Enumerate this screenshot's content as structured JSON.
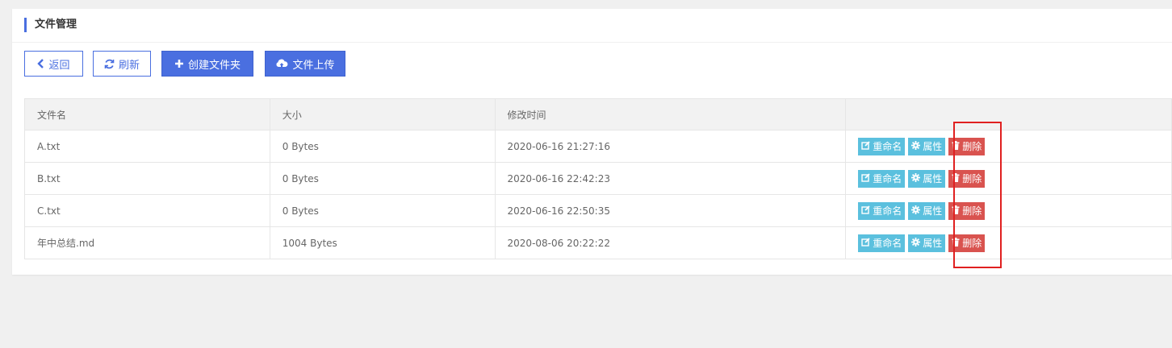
{
  "panel": {
    "title": "文件管理"
  },
  "toolbar": {
    "back_label": "返回",
    "refresh_label": "刷新",
    "new_folder_label": "创建文件夹",
    "upload_label": "文件上传"
  },
  "table": {
    "columns": [
      "文件名",
      "大小",
      "修改时间",
      ""
    ],
    "rows": [
      {
        "name": "A.txt",
        "size": "0 Bytes",
        "modified": "2020-06-16 21:27:16"
      },
      {
        "name": "B.txt",
        "size": "0 Bytes",
        "modified": "2020-06-16 22:42:23"
      },
      {
        "name": "C.txt",
        "size": "0 Bytes",
        "modified": "2020-06-16 22:50:35"
      },
      {
        "name": "年中总结.md",
        "size": "1004 Bytes",
        "modified": "2020-08-06 20:22:22"
      }
    ],
    "actions": {
      "rename_label": "重命名",
      "props_label": "属性",
      "delete_label": "删除"
    }
  },
  "icons": {
    "back": "chevron-left-icon",
    "refresh": "refresh-icon",
    "new_folder": "plus-icon",
    "upload": "cloud-upload-icon",
    "rename": "edit-icon",
    "props": "gear-icon",
    "delete": "trash-icon"
  },
  "colors": {
    "primary": "#4a6fe0",
    "info": "#5bc0de",
    "danger": "#d9534f",
    "highlight": "#e02020"
  }
}
